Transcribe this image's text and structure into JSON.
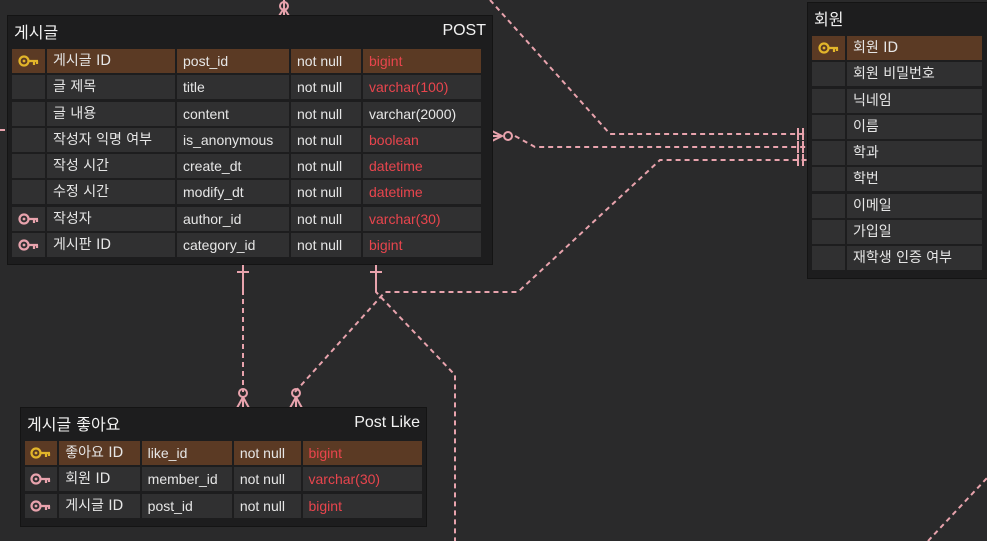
{
  "colors": {
    "pk_row": "#5b3a24",
    "pk_key": "#e2b52a",
    "fk_key": "#e8a3ad",
    "type_red": "#e8454d",
    "connector": "#e8a3ad"
  },
  "entities": {
    "post": {
      "title": "게시글",
      "physical_name": "POST",
      "rows": [
        {
          "key": "pk-key-icon",
          "name": "게시글 ID",
          "column": "post_id",
          "null": "not null",
          "type": "bigint",
          "type_color": "red"
        },
        {
          "key": "",
          "name": "글 제목",
          "column": "title",
          "null": "not null",
          "type": "varchar(100)",
          "type_color": "red"
        },
        {
          "key": "",
          "name": "글 내용",
          "column": "content",
          "null": "not null",
          "type": "varchar(2000)",
          "type_color": "white"
        },
        {
          "key": "",
          "name": "작성자 익명 여부",
          "column": "is_anonymous",
          "null": "not null",
          "type": "boolean",
          "type_color": "red"
        },
        {
          "key": "",
          "name": "작성 시간",
          "column": "create_dt",
          "null": "not null",
          "type": "datetime",
          "type_color": "red"
        },
        {
          "key": "",
          "name": "수정 시간",
          "column": "modify_dt",
          "null": "not null",
          "type": "datetime",
          "type_color": "red"
        },
        {
          "key": "fk-key-icon",
          "name": "작성자",
          "column": "author_id",
          "null": "not null",
          "type": "varchar(30)",
          "type_color": "red"
        },
        {
          "key": "fk-key-icon",
          "name": "게시판 ID",
          "column": "category_id",
          "null": "not null",
          "type": "bigint",
          "type_color": "red"
        }
      ]
    },
    "post_like": {
      "title": "게시글 좋아요",
      "physical_name": "Post Like",
      "rows": [
        {
          "key": "pk-key-icon",
          "name": "좋아요 ID",
          "column": "like_id",
          "null": "not null",
          "type": "bigint",
          "type_color": "red"
        },
        {
          "key": "fk-key-icon",
          "name": "회원 ID",
          "column": "member_id",
          "null": "not null",
          "type": "varchar(30)",
          "type_color": "red"
        },
        {
          "key": "fk-key-icon",
          "name": "게시글 ID",
          "column": "post_id",
          "null": "not null",
          "type": "bigint",
          "type_color": "red"
        }
      ]
    },
    "member": {
      "title": "회원",
      "physical_name": "",
      "rows": [
        {
          "key": "pk-key-icon",
          "name": "회원 ID"
        },
        {
          "key": "",
          "name": "회원 비밀번호"
        },
        {
          "key": "",
          "name": "닉네임"
        },
        {
          "key": "",
          "name": "이름"
        },
        {
          "key": "",
          "name": "학과"
        },
        {
          "key": "",
          "name": "학번"
        },
        {
          "key": "",
          "name": "이메일"
        },
        {
          "key": "",
          "name": "가입일"
        },
        {
          "key": "",
          "name": "재학생 인증 여부"
        }
      ]
    }
  }
}
